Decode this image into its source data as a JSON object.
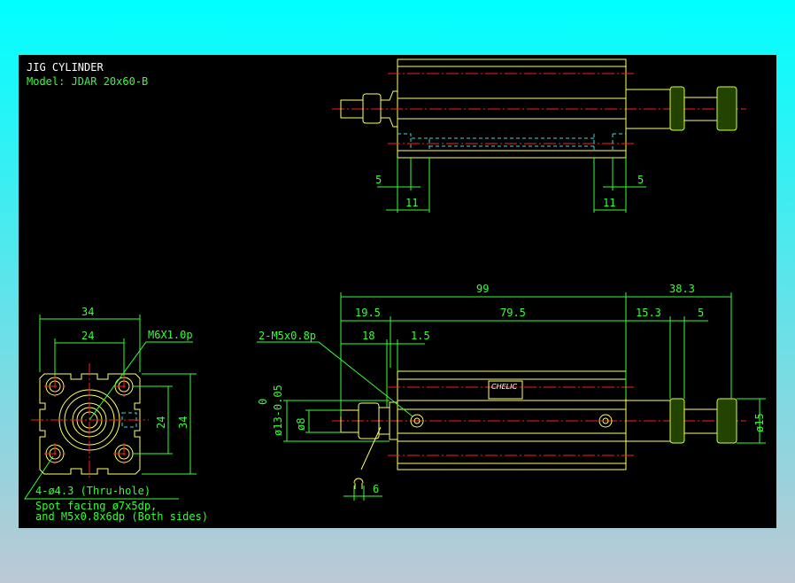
{
  "title": "JIG CYLINDER",
  "model": "Model: JDAR 20x60-B",
  "colors": {
    "background_top": "#00ffff",
    "background_bottom": "#bcc8d4",
    "canvas": "#000000",
    "outline": "#ffff66",
    "dimension": "#33ff33",
    "centerline": "#ff2020",
    "hidden": "#33dddd"
  },
  "top_view": {
    "dims": {
      "left_5": "5",
      "left_11": "11",
      "right_5": "5",
      "right_11": "11"
    }
  },
  "end_view": {
    "dims": {
      "width_34": "34",
      "width_24": "24",
      "height_24": "24",
      "height_34": "34"
    },
    "port_label": "M6X1.0p",
    "hole_note": "4-ø4.3 (Thru-hole)",
    "spot_facing_1": "Spot facing ø7x5dp,",
    "spot_facing_2": "and M5x0.8x6dp (Both sides)"
  },
  "front_view": {
    "dims": {
      "total": "99",
      "stroke": "38.3",
      "d19_5": "19.5",
      "d79_5": "79.5",
      "d15_3": "15.3",
      "d5": "5",
      "d18": "18",
      "d1_5": "1.5",
      "wrench": "6",
      "dia13_tol": "0",
      "dia13": "ø13-0.05",
      "dia8": "ø8",
      "dia15": "ø15"
    },
    "port_label": "2-M5x0.8p",
    "nameplate": "CHELIC"
  }
}
